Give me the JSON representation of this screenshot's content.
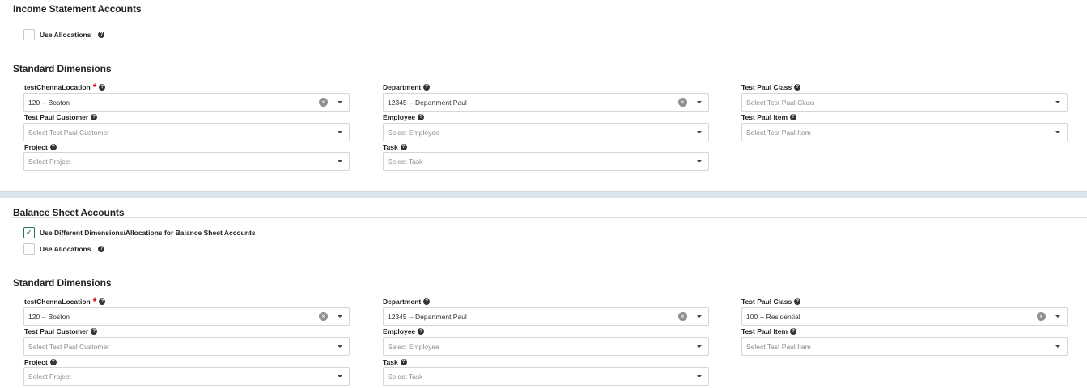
{
  "income": {
    "title": "Income Statement Accounts",
    "use_allocations_label": "Use Allocations",
    "dimensions_title": "Standard Dimensions",
    "fields": {
      "location": {
        "label": "testChennaLocation",
        "value": "120 -- Boston"
      },
      "department": {
        "label": "Department",
        "value": "12345 -- Department Paul"
      },
      "class": {
        "label": "Test Paul Class",
        "placeholder": "Select Test Paul Class"
      },
      "customer": {
        "label": "Test Paul Customer",
        "placeholder": "Select Test Paul Customer"
      },
      "employee": {
        "label": "Employee",
        "placeholder": "Select Employee"
      },
      "item": {
        "label": "Test Paul Item",
        "placeholder": "Select Test Paul Item"
      },
      "project": {
        "label": "Project",
        "placeholder": "Select Project"
      },
      "task": {
        "label": "Task",
        "placeholder": "Select Task"
      }
    }
  },
  "balance": {
    "title": "Balance Sheet Accounts",
    "use_different_label": "Use Different Dimensions/Allocations for Balance Sheet Accounts",
    "use_allocations_label": "Use Allocations",
    "dimensions_title": "Standard Dimensions",
    "fields": {
      "location": {
        "label": "testChennaLocation",
        "value": "120 -- Boston"
      },
      "department": {
        "label": "Department",
        "value": "12345 -- Department Paul"
      },
      "class": {
        "label": "Test Paul Class",
        "value": "100 -- Residential"
      },
      "customer": {
        "label": "Test Paul Customer",
        "placeholder": "Select Test Paul Customer"
      },
      "employee": {
        "label": "Employee",
        "placeholder": "Select Employee"
      },
      "item": {
        "label": "Test Paul Item",
        "placeholder": "Select Test Paul Item"
      },
      "project": {
        "label": "Project",
        "placeholder": "Select Project"
      },
      "task": {
        "label": "Task",
        "placeholder": "Select Task"
      }
    }
  },
  "icons": {
    "help": "question-circle-icon",
    "clear": "clear-circle-icon",
    "caret": "caret-down-icon"
  },
  "colors": {
    "required": "#d0021b",
    "checked": "#1a7a55",
    "band": "#dde6ee"
  }
}
